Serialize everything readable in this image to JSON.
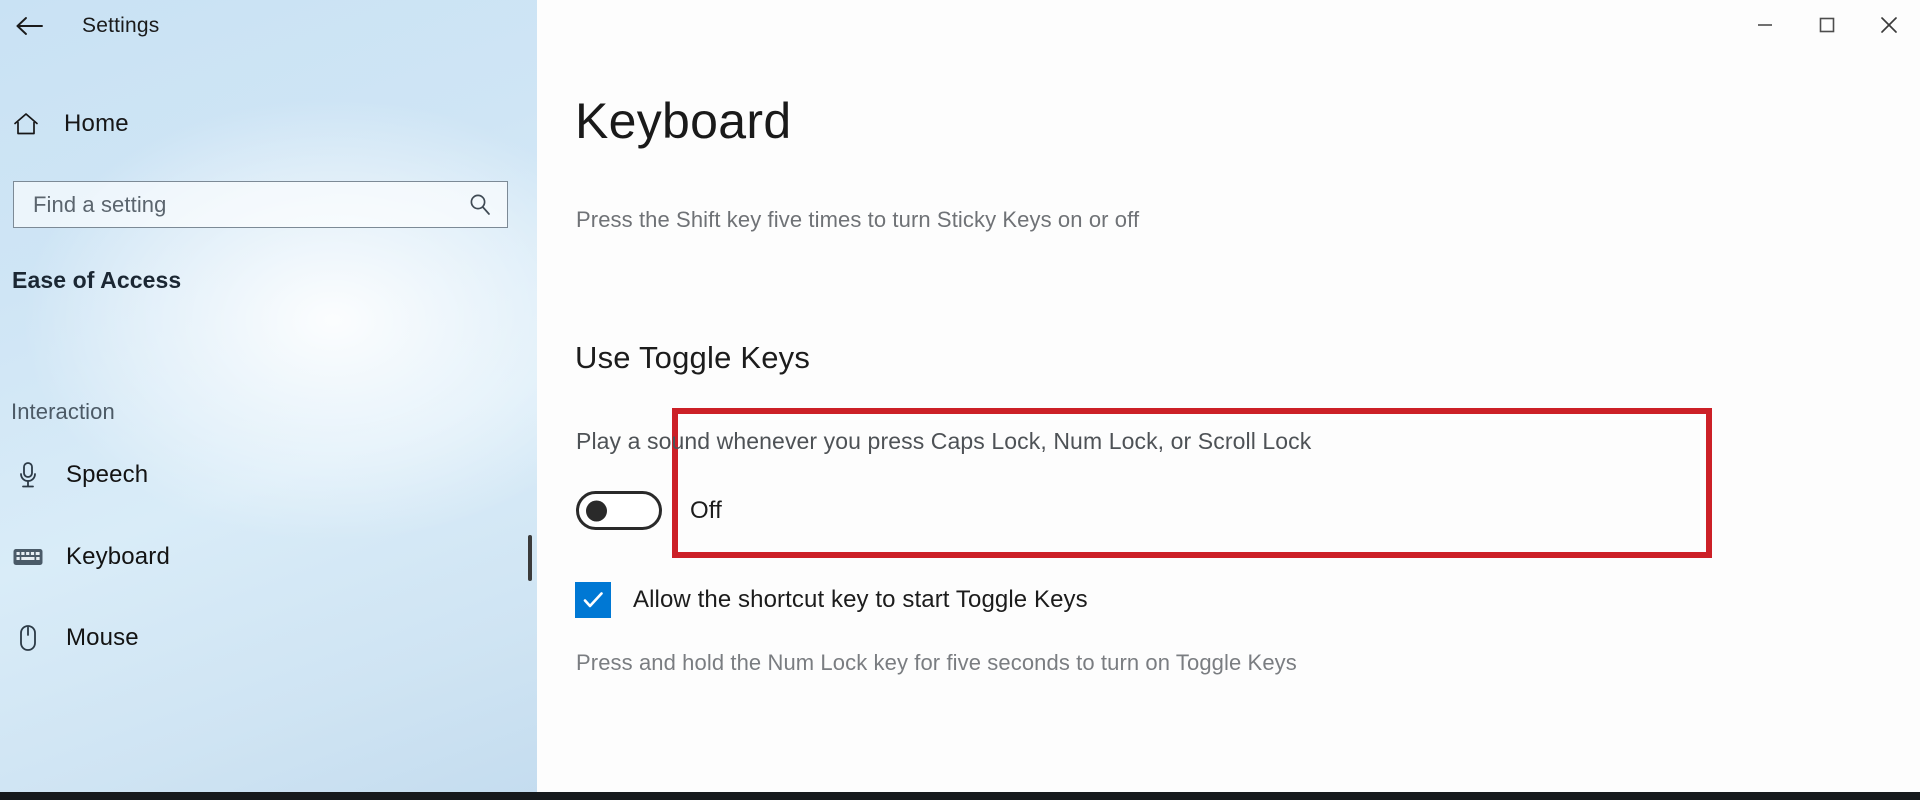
{
  "window": {
    "title": "Settings",
    "back_icon": "back-arrow-icon",
    "controls": {
      "minimize": "minimize-icon",
      "maximize": "maximize-icon",
      "close": "close-icon"
    }
  },
  "sidebar": {
    "home": {
      "label": "Home",
      "icon": "home-icon"
    },
    "search": {
      "placeholder": "Find a setting",
      "value": "",
      "icon": "search-icon"
    },
    "group_header": "Ease of Access",
    "section_label": "Interaction",
    "items": [
      {
        "label": "Speech",
        "icon": "microphone-icon",
        "selected": false
      },
      {
        "label": "Keyboard",
        "icon": "keyboard-icon",
        "selected": true
      },
      {
        "label": "Mouse",
        "icon": "mouse-icon",
        "selected": false
      }
    ]
  },
  "main": {
    "title": "Keyboard",
    "subtitle": "Press the Shift key five times to turn Sticky Keys on or off",
    "section_title": "Use Toggle Keys",
    "toggle_setting": {
      "label": "Play a sound whenever you press Caps Lock, Num Lock, or Scroll Lock",
      "state_label": "Off",
      "checked": false,
      "highlighted": true
    },
    "checkbox_setting": {
      "label": "Allow the shortcut key to start Toggle Keys",
      "checked": true,
      "icon": "checkmark-icon"
    },
    "help_text": "Press and hold the Num Lock key for five seconds to turn on Toggle Keys"
  },
  "colors": {
    "accent": "#0078d4",
    "annotation": "#cc2027",
    "sidebar_bg": "#cfe5f5",
    "content_bg": "#fdfdfd",
    "text_primary": "#1c1c1c",
    "text_secondary": "#7a7d81"
  }
}
